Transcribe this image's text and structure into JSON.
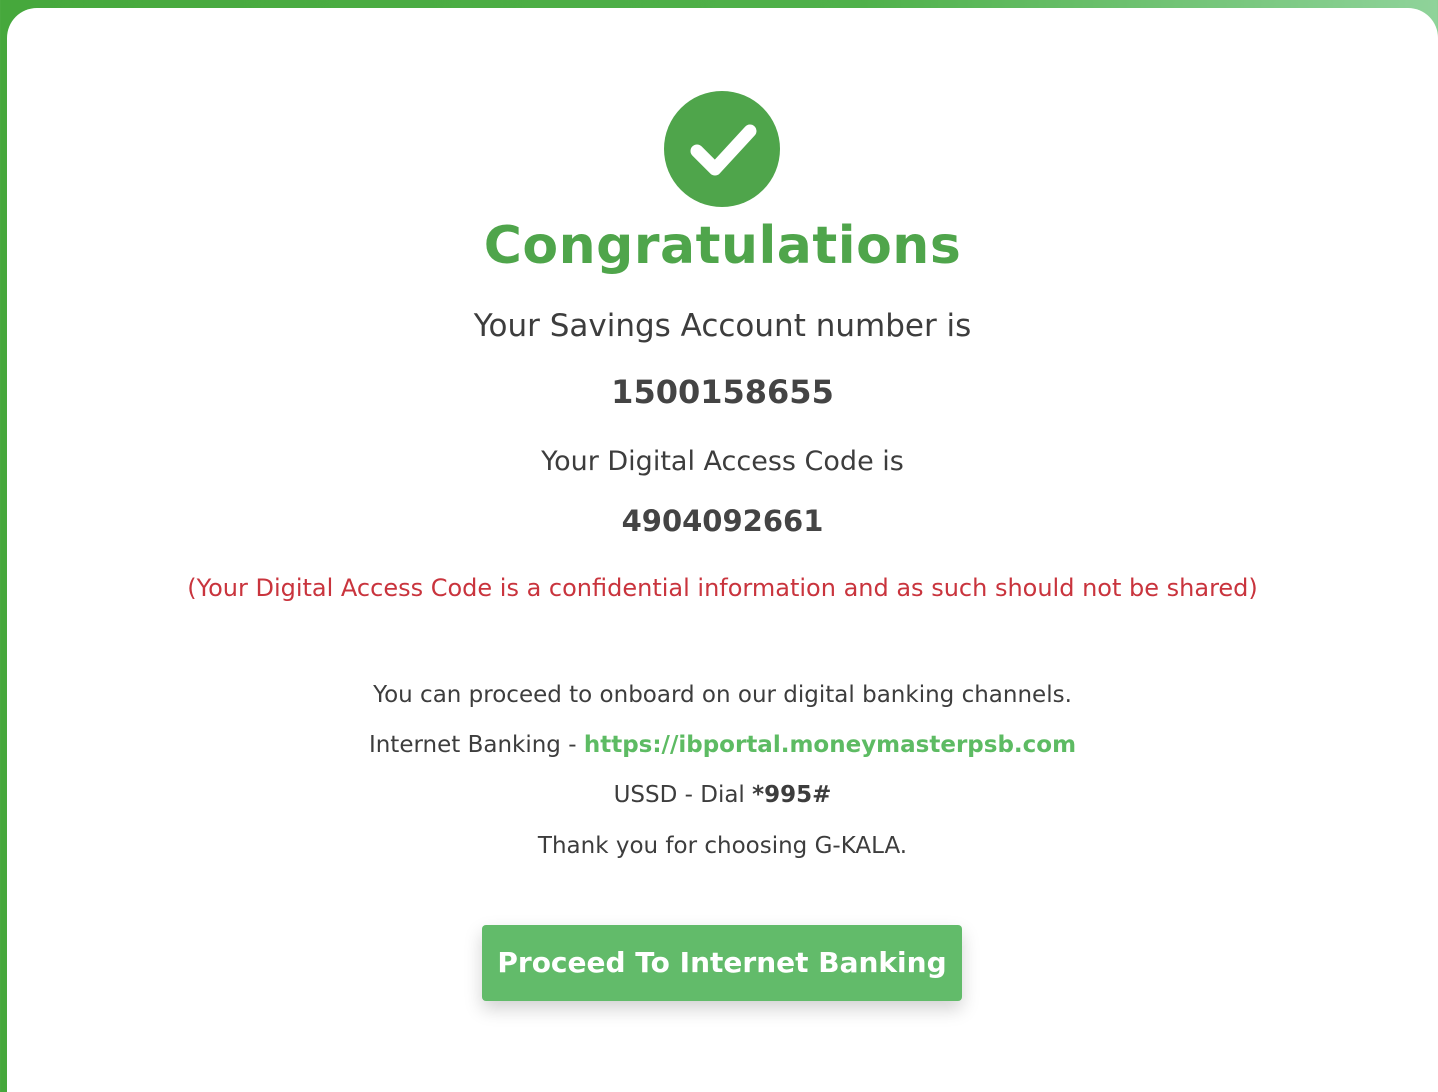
{
  "colors": {
    "brand_green": "#4fa54b",
    "link_green": "#5dbb63",
    "warning_red": "#c9343d",
    "button_green": "#62bb6a"
  },
  "icon": {
    "success": "check-circle-icon"
  },
  "success": {
    "title": "Congratulations",
    "account_label": "Your Savings Account number is",
    "account_number": "1500158655",
    "access_code_label": "Your Digital Access Code is",
    "access_code": "4904092661",
    "warning": "(Your Digital Access Code is a confidential information and as such should not be shared)",
    "onboard_text": "You can proceed to onboard on our digital banking channels.",
    "internet_banking_label": "Internet Banking - ",
    "internet_banking_url": "https://ibportal.moneymasterpsb.com",
    "ussd_label": "USSD - Dial ",
    "ussd_code": "*995#",
    "thanks": "Thank you for choosing G-KALA."
  },
  "actions": {
    "proceed_label": "Proceed To Internet Banking"
  }
}
